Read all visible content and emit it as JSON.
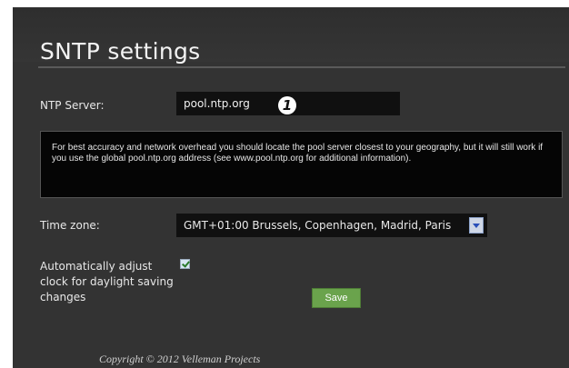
{
  "page": {
    "title": "SNTP settings"
  },
  "ntp": {
    "label": "NTP Server:",
    "value": "pool.ntp.org",
    "annotation_number": "1"
  },
  "info": {
    "text": "For best accuracy and network overhead you should locate the pool server closest to your geography, but it will still work if you use the global pool.ntp.org address (see www.pool.ntp.org for additional information)."
  },
  "timezone": {
    "label": "Time zone:",
    "selected": "GMT+01:00 Brussels, Copenhagen, Madrid, Paris"
  },
  "dst": {
    "label": "Automatically adjust clock for daylight saving changes",
    "checked": true
  },
  "actions": {
    "save_label": "Save"
  },
  "footer": {
    "copyright": "Copyright © 2012 Velleman Projects"
  },
  "colors": {
    "panel_background": "#333333",
    "input_background": "#101010",
    "save_button": "#6aa34c"
  }
}
